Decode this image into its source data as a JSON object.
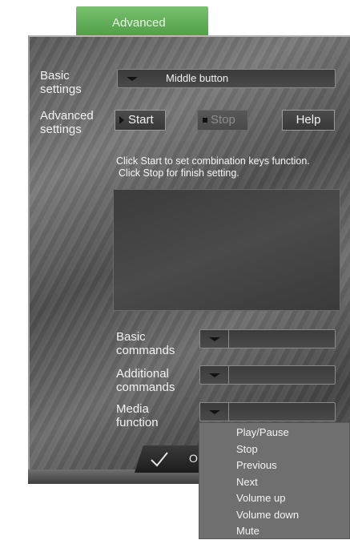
{
  "tab": {
    "label": "Advanced"
  },
  "labels": {
    "basic_settings": [
      "Basic",
      "settings"
    ],
    "advanced_settings": [
      "Advanced",
      "settings"
    ],
    "basic_commands": [
      "Basic",
      "commands"
    ],
    "additional_commands": [
      "Additional",
      "commands"
    ],
    "media_function": [
      "Media",
      "function"
    ]
  },
  "basic_settings_select": {
    "value": "Middle button"
  },
  "buttons": {
    "start": "Start",
    "stop": "Stop",
    "help": "Help",
    "ok": "O"
  },
  "info": {
    "line1": "Click Start to set combination keys function.",
    "line2": "Click Stop for finish setting."
  },
  "media_dropdown": {
    "options": [
      "Play/Pause",
      "Stop",
      "Previous",
      "Next",
      "Volume up",
      "Volume down",
      "Mute"
    ]
  }
}
